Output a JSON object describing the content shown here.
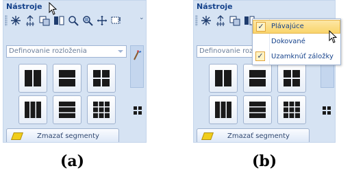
{
  "panel_a": {
    "title": "Nástroje",
    "dropdown_label": "Definovanie rozloženia",
    "clear_button_label": "Zmazať segmenty",
    "caption": "(a)"
  },
  "panel_b": {
    "title": "Nástroje",
    "dropdown_label": "Definovanie rozloženia",
    "clear_button_label": "Zmazať segmenty",
    "caption": "(b)",
    "context_menu": {
      "items": [
        {
          "label": "Plávajúce",
          "checked": true,
          "highlighted": true
        },
        {
          "label": "Dokované",
          "checked": false,
          "highlighted": false
        },
        {
          "label": "Uzamknúť záložky",
          "checked": true,
          "highlighted": false
        }
      ]
    }
  },
  "colors": {
    "panel_bg": "#d6e3f3",
    "title_text": "#15428b",
    "menu_highlight": "#f9d46b"
  },
  "icons": [
    "pointer-icon",
    "arrange-icon",
    "copy-icon",
    "columns-icon",
    "zoom-icon",
    "zoom-region-icon",
    "pan-icon",
    "window-icon",
    "more-arrow-icon",
    "eraser-icon",
    "color-wand-icon",
    "layout-grid-icon"
  ]
}
